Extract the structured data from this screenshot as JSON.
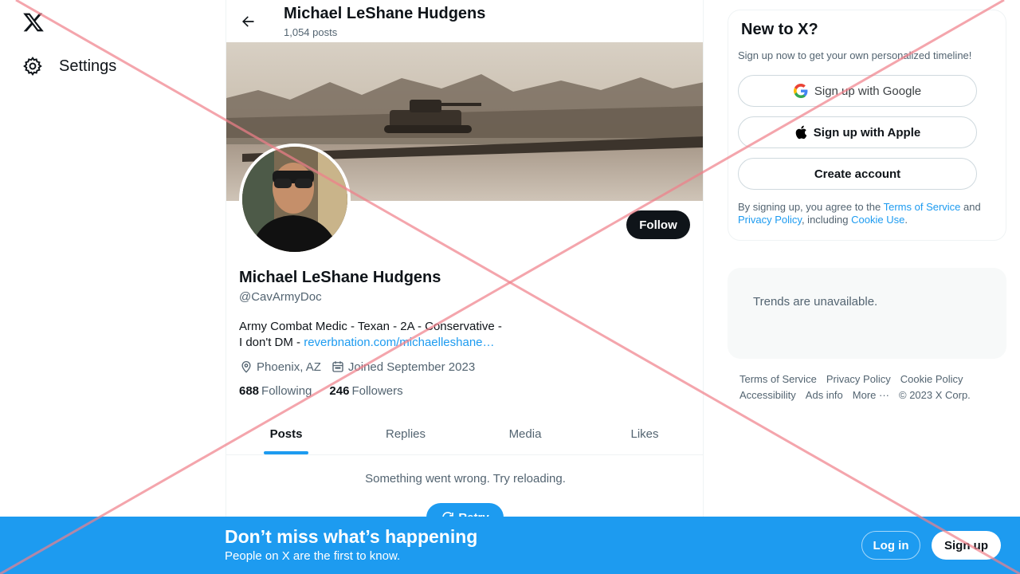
{
  "colors": {
    "accent": "#1d9bf0",
    "text": "#0f1419",
    "muted": "#536471",
    "cross": "#f07f8a"
  },
  "nav": {
    "logo_icon": "x-logo-icon",
    "settings_label": "Settings"
  },
  "header": {
    "title": "Michael LeShane Hudgens",
    "post_count": "1,054 posts"
  },
  "profile": {
    "name": "Michael LeShane Hudgens",
    "handle": "@CavArmyDoc",
    "follow_label": "Follow",
    "bio_line1": "Army Combat Medic - Texan - 2A - Conservative -",
    "bio_line2": "I don't DM  - ",
    "bio_link": "reverbnation.com/michaelleshane…",
    "location": "Phoenix, AZ",
    "joined": "Joined September 2023",
    "following_count": "688",
    "following_label": "Following",
    "followers_count": "246",
    "followers_label": "Followers"
  },
  "tabs": [
    {
      "label": "Posts",
      "active": true
    },
    {
      "label": "Replies",
      "active": false
    },
    {
      "label": "Media",
      "active": false
    },
    {
      "label": "Likes",
      "active": false
    }
  ],
  "feed": {
    "error": "Something went wrong. Try reloading.",
    "retry_label": "Retry"
  },
  "signup": {
    "title": "New to X?",
    "subtitle": "Sign up now to get your own personalized timeline!",
    "google_label": "Sign up with Google",
    "apple_label": "Sign up with Apple",
    "create_label": "Create account",
    "legal_prefix": "By signing up, you agree to the ",
    "terms_link": "Terms of Service",
    "legal_and": " and",
    "privacy_link": "Privacy Policy",
    "legal_including": ", including ",
    "cookie_link": "Cookie Use",
    "legal_end": "."
  },
  "trends": {
    "text": "Trends are unavailable."
  },
  "footer": {
    "links": [
      "Terms of Service",
      "Privacy Policy",
      "Cookie Policy",
      "Accessibility",
      "Ads info",
      "More ···",
      "© 2023 X Corp."
    ]
  },
  "bottom_bar": {
    "title": "Don’t miss what’s happening",
    "subtitle": "People on X are the first to know.",
    "login_label": "Log in",
    "signup_label": "Sign up"
  }
}
